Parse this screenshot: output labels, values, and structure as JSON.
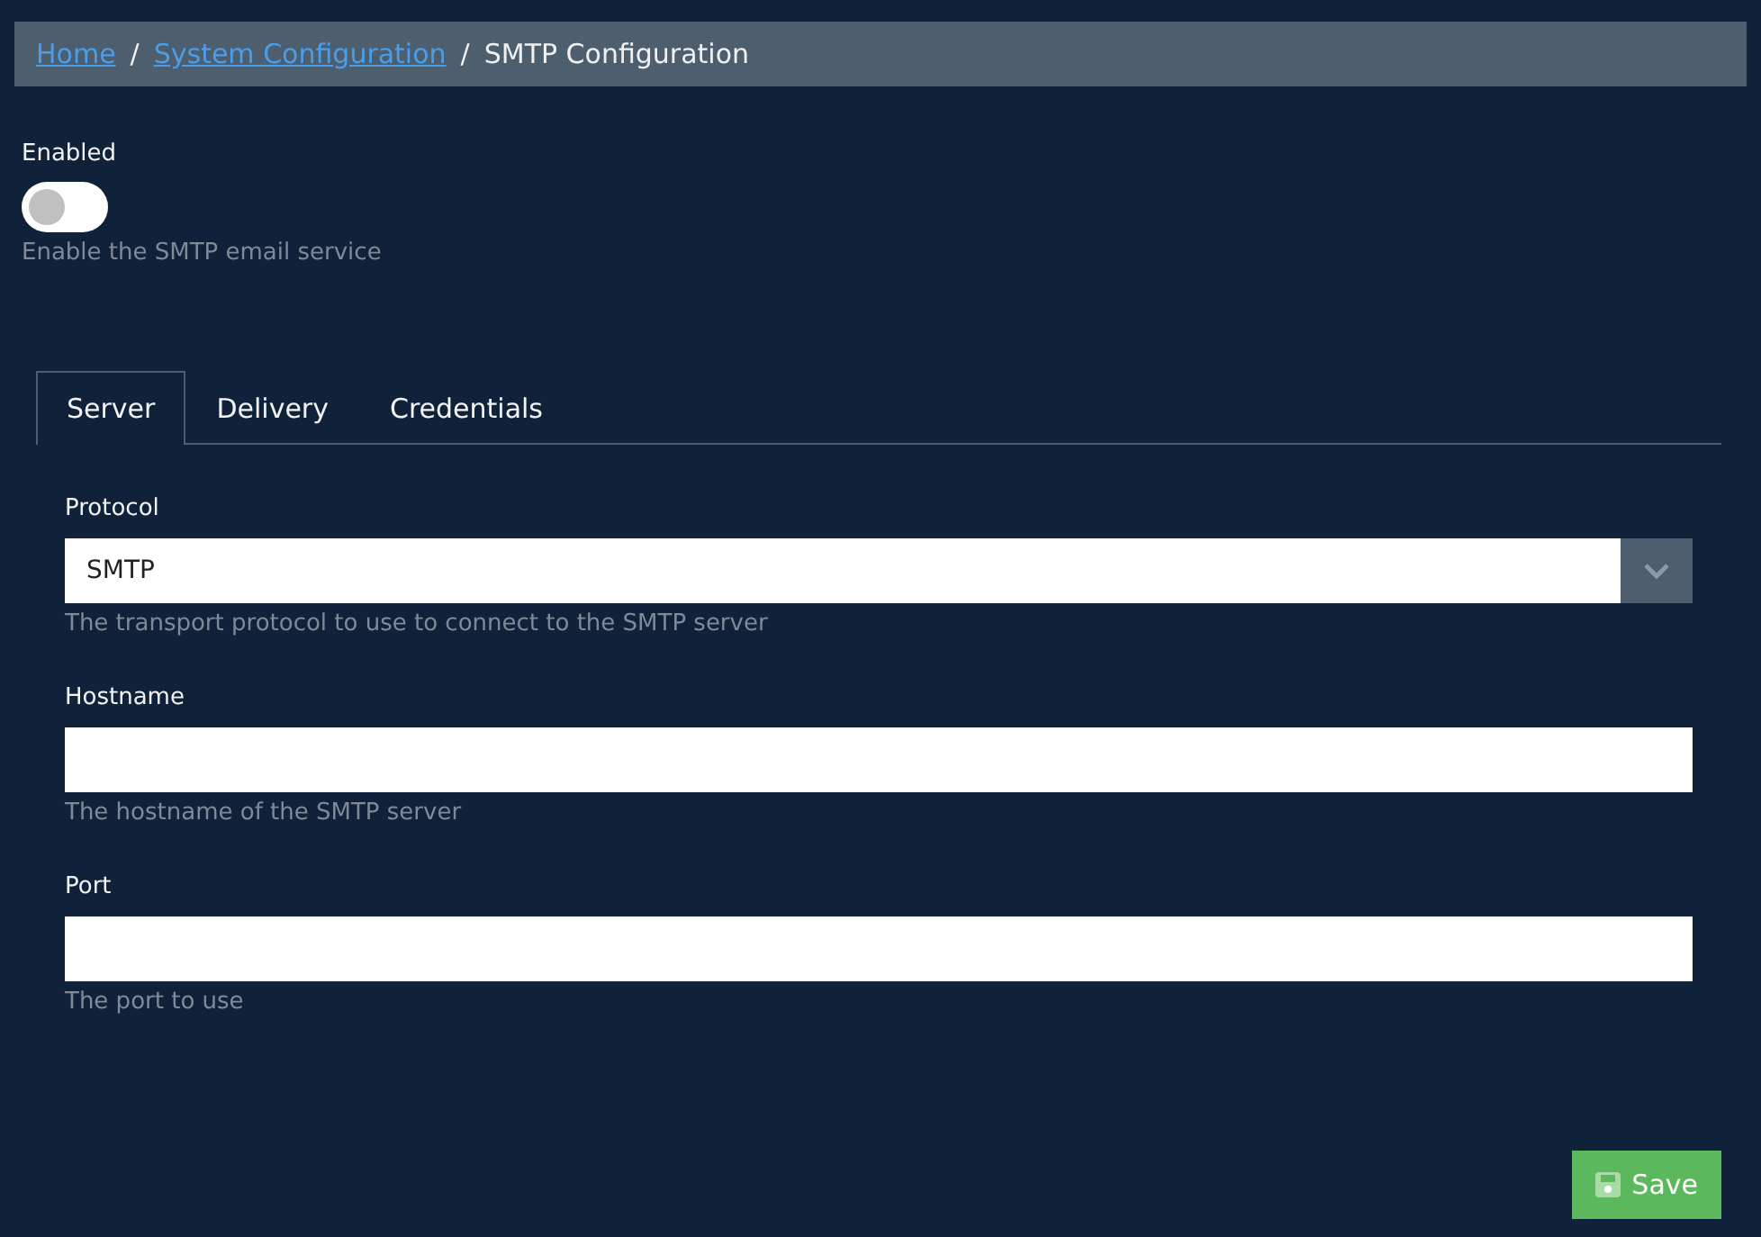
{
  "breadcrumb": [
    {
      "label": "Home",
      "kind": "link"
    },
    {
      "label": "/",
      "kind": "separator"
    },
    {
      "label": "System Configuration",
      "kind": "link"
    },
    {
      "label": "/",
      "kind": "separator"
    },
    {
      "label": "SMTP Configuration",
      "kind": "current"
    }
  ],
  "enabled": {
    "label": "Enabled",
    "on": false,
    "help": "Enable the SMTP email service"
  },
  "tabs": [
    {
      "label": "Server",
      "selected": true
    },
    {
      "label": "Delivery",
      "selected": false
    },
    {
      "label": "Credentials",
      "selected": false
    }
  ],
  "fields": [
    {
      "label": "Protocol",
      "kind": "select",
      "value": "SMTP",
      "help": "The transport protocol to use to connect to the SMTP server"
    },
    {
      "label": "Hostname",
      "kind": "text",
      "help": "The hostname of the SMTP server"
    },
    {
      "label": "Port",
      "kind": "text",
      "help": "The port to use"
    }
  ],
  "save_button": "Save"
}
